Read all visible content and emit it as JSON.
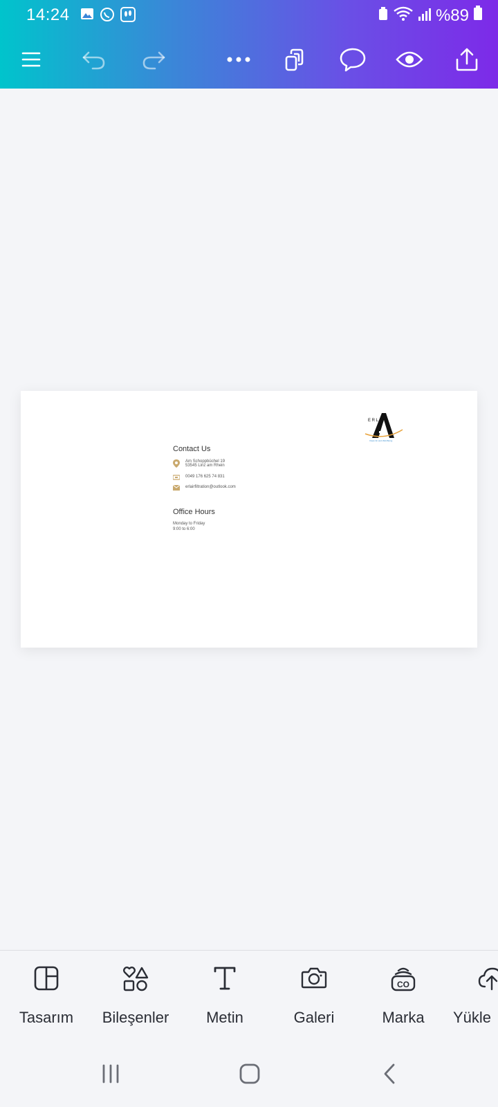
{
  "status_bar": {
    "time": "14:24",
    "battery": "%89"
  },
  "design": {
    "contact_title": "Contact Us",
    "address_line1": "Am Schoppbüchel 19",
    "address_line2": "53545 Linz am Rhein",
    "phone": "0049 176 625 74 831",
    "email": "erlairfiltration@outlook.com",
    "office_title": "Office Hours",
    "office_days": "Monday to Friday",
    "office_time": "9:00 to 6:00",
    "logo_letters": "E R L",
    "logo_tagline": "Clean Air and Well-Being"
  },
  "bottom_nav": [
    {
      "label": "Tasarım",
      "icon": "layout-icon"
    },
    {
      "label": "Bileşenler",
      "icon": "elements-icon"
    },
    {
      "label": "Metin",
      "icon": "text-icon"
    },
    {
      "label": "Galeri",
      "icon": "camera-icon"
    },
    {
      "label": "Marka",
      "icon": "brand-icon"
    },
    {
      "label": "Yükle",
      "icon": "upload-cloud-icon"
    }
  ],
  "colors": {
    "accent_gradient_start": "#00c4cc",
    "accent_gradient_end": "#7d2ae8",
    "icon_gold": "#c9a96e"
  }
}
